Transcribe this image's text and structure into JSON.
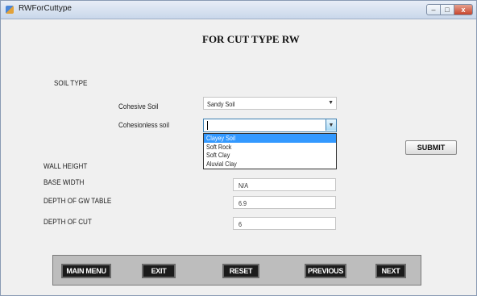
{
  "window": {
    "title": "RWForCuttype",
    "controls": {
      "minimize": "–",
      "maximize": "□",
      "close": "x"
    }
  },
  "form": {
    "heading": "FOR CUT TYPE RW",
    "soil_type_label": "SOIL TYPE",
    "cohesive": {
      "label": "Cohesive Soil",
      "value": "Sandy Soil"
    },
    "cohesionless": {
      "label": "Cohesionless soil",
      "value": "",
      "options": [
        "Clayey Soil",
        "Soft Rock",
        "Soft Clay",
        "Aluvial Clay"
      ],
      "highlighted_index": 0
    },
    "wall_height": {
      "label": "WALL HEIGHT",
      "value": ""
    },
    "base_width": {
      "label": "BASE WIDTH",
      "value": "N/A"
    },
    "depth_gw_table": {
      "label": "DEPTH OF GW TABLE",
      "value": "6.9"
    },
    "depth_cut": {
      "label": "DEPTH OF CUT",
      "value": "6"
    },
    "submit_label": "SUBMIT"
  },
  "buttons": {
    "main_menu": "MAIN MENU",
    "exit": "EXIT",
    "reset": "RESET",
    "previous": "PREVIOUS",
    "next": "NEXT"
  }
}
